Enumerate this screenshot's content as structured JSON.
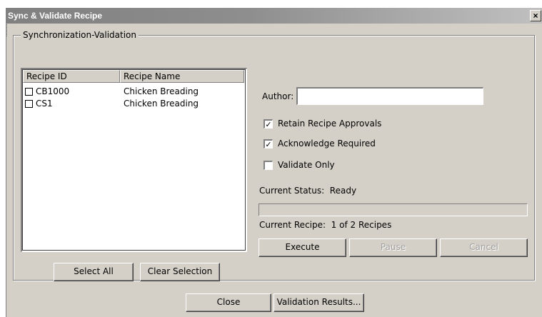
{
  "window": {
    "title": "Sync & Validate Recipe",
    "close_glyph": "×"
  },
  "group": {
    "legend": "Synchronization-Validation"
  },
  "recipe_list": {
    "columns": [
      "Recipe ID",
      "Recipe Name"
    ],
    "rows": [
      {
        "id": "CB1000",
        "name": "Chicken Breading",
        "checked": false
      },
      {
        "id": "CS1",
        "name": "Chicken Breading",
        "checked": false
      }
    ]
  },
  "form": {
    "author_label": "Author:",
    "author_value": "",
    "options": [
      {
        "label": "Retain Recipe Approvals",
        "checked": true
      },
      {
        "label": "Acknowledge Required",
        "checked": true
      },
      {
        "label": "Validate Only",
        "checked": false
      }
    ],
    "status_text": "Current Status:  Ready",
    "progress": 0,
    "current_recipe_text": "Current Recipe:  1 of 2 Recipes"
  },
  "buttons": {
    "execute": "Execute",
    "pause": "Pause",
    "cancel": "Cancel",
    "select_all": "Select All",
    "clear_selection": "Clear Selection",
    "close": "Close",
    "validation_results": "Validation Results..."
  },
  "colors": {
    "dialog_bg": "#d4d0c8",
    "titlebar": "#808080"
  }
}
